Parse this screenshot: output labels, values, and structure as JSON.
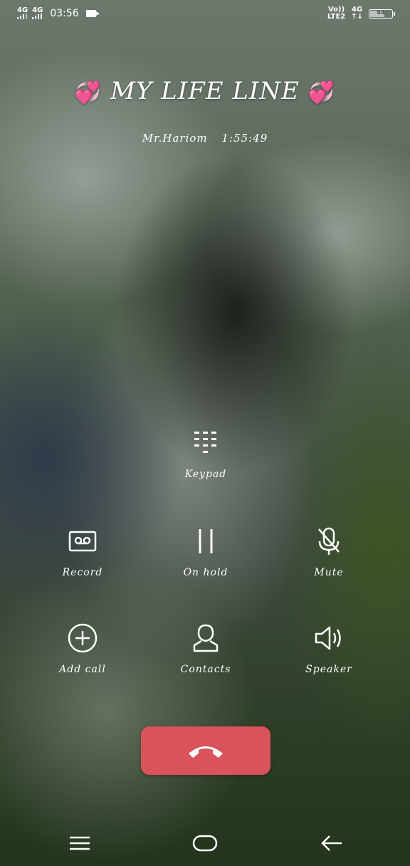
{
  "status_bar": {
    "sim1_network": "4G",
    "sim2_network": "4G",
    "time": "03:56",
    "volte_label": "Vo))",
    "lte_label": "LTE2",
    "data_network": "4G",
    "data_arrows": "↑↓",
    "battery_level": "64"
  },
  "call": {
    "contact_name": "MY LIFE LINE",
    "caller_label": "Mr.Hariom",
    "duration": "1:55:49"
  },
  "controls": {
    "keypad": "Keypad",
    "record": "Record",
    "hold": "On hold",
    "mute": "Mute",
    "add_call": "Add call",
    "contacts": "Contacts",
    "speaker": "Speaker"
  },
  "colors": {
    "end_call": "#d9535a",
    "heart": "#f06a8a"
  },
  "icons": [
    "keypad-icon",
    "record-icon",
    "pause-icon",
    "mute-mic-icon",
    "add-call-icon",
    "contacts-icon",
    "speaker-icon",
    "end-call-icon",
    "menu-icon",
    "home-icon",
    "back-icon"
  ]
}
